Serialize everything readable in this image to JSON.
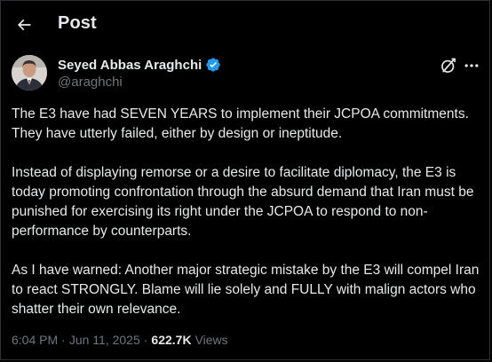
{
  "header": {
    "title": "Post",
    "back_icon": "arrow-left-icon"
  },
  "author": {
    "display_name": "Seyed Abbas Araghchi",
    "handle": "@araghchi",
    "verified": true,
    "verified_color": "#1d9bf0"
  },
  "actions": {
    "grok_icon": "grok-icon",
    "more_icon": "more-dots-icon"
  },
  "tweet": {
    "paragraphs": [
      "The E3 have had SEVEN YEARS to implement their JCPOA commitments. They have utterly failed, either by design or ineptitude.",
      "Instead of displaying remorse or a desire to facilitate diplomacy, the E3 is today promoting confrontation through the absurd demand that Iran must be punished for exercising its right under the JCPOA to respond to non-performance by counterparts.",
      "As I have warned: Another major strategic mistake by the E3 will compel Iran to react STRONGLY. Blame will lie solely and FULLY with malign actors who shatter their own relevance."
    ]
  },
  "meta": {
    "time": "6:04 PM",
    "separator": "·",
    "date": "Jun 11, 2025",
    "views_count": "622.7K",
    "views_label": "Views"
  },
  "colors": {
    "background": "#000000",
    "text": "#e7e9ea",
    "secondary": "#71767b",
    "accent": "#1d9bf0"
  }
}
